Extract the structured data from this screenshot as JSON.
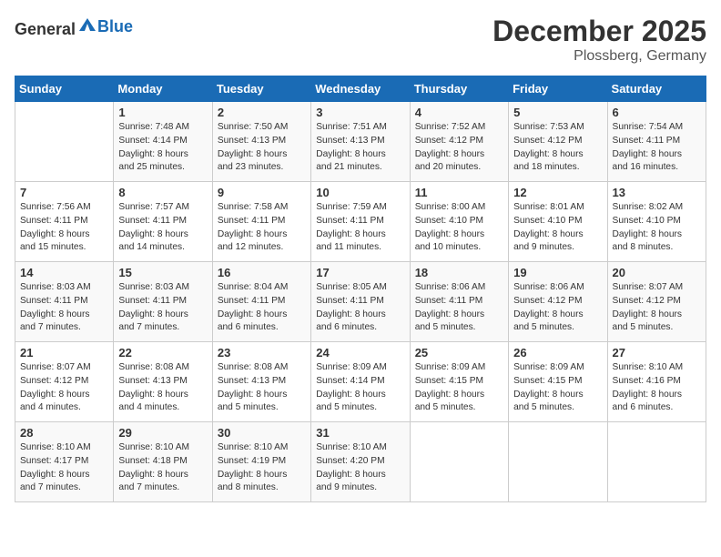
{
  "header": {
    "logo_general": "General",
    "logo_blue": "Blue",
    "month": "December 2025",
    "location": "Plossberg, Germany"
  },
  "days_of_week": [
    "Sunday",
    "Monday",
    "Tuesday",
    "Wednesday",
    "Thursday",
    "Friday",
    "Saturday"
  ],
  "weeks": [
    [
      {
        "num": "",
        "info": ""
      },
      {
        "num": "1",
        "info": "Sunrise: 7:48 AM\nSunset: 4:14 PM\nDaylight: 8 hours\nand 25 minutes."
      },
      {
        "num": "2",
        "info": "Sunrise: 7:50 AM\nSunset: 4:13 PM\nDaylight: 8 hours\nand 23 minutes."
      },
      {
        "num": "3",
        "info": "Sunrise: 7:51 AM\nSunset: 4:13 PM\nDaylight: 8 hours\nand 21 minutes."
      },
      {
        "num": "4",
        "info": "Sunrise: 7:52 AM\nSunset: 4:12 PM\nDaylight: 8 hours\nand 20 minutes."
      },
      {
        "num": "5",
        "info": "Sunrise: 7:53 AM\nSunset: 4:12 PM\nDaylight: 8 hours\nand 18 minutes."
      },
      {
        "num": "6",
        "info": "Sunrise: 7:54 AM\nSunset: 4:11 PM\nDaylight: 8 hours\nand 16 minutes."
      }
    ],
    [
      {
        "num": "7",
        "info": "Sunrise: 7:56 AM\nSunset: 4:11 PM\nDaylight: 8 hours\nand 15 minutes."
      },
      {
        "num": "8",
        "info": "Sunrise: 7:57 AM\nSunset: 4:11 PM\nDaylight: 8 hours\nand 14 minutes."
      },
      {
        "num": "9",
        "info": "Sunrise: 7:58 AM\nSunset: 4:11 PM\nDaylight: 8 hours\nand 12 minutes."
      },
      {
        "num": "10",
        "info": "Sunrise: 7:59 AM\nSunset: 4:11 PM\nDaylight: 8 hours\nand 11 minutes."
      },
      {
        "num": "11",
        "info": "Sunrise: 8:00 AM\nSunset: 4:10 PM\nDaylight: 8 hours\nand 10 minutes."
      },
      {
        "num": "12",
        "info": "Sunrise: 8:01 AM\nSunset: 4:10 PM\nDaylight: 8 hours\nand 9 minutes."
      },
      {
        "num": "13",
        "info": "Sunrise: 8:02 AM\nSunset: 4:10 PM\nDaylight: 8 hours\nand 8 minutes."
      }
    ],
    [
      {
        "num": "14",
        "info": "Sunrise: 8:03 AM\nSunset: 4:11 PM\nDaylight: 8 hours\nand 7 minutes."
      },
      {
        "num": "15",
        "info": "Sunrise: 8:03 AM\nSunset: 4:11 PM\nDaylight: 8 hours\nand 7 minutes."
      },
      {
        "num": "16",
        "info": "Sunrise: 8:04 AM\nSunset: 4:11 PM\nDaylight: 8 hours\nand 6 minutes."
      },
      {
        "num": "17",
        "info": "Sunrise: 8:05 AM\nSunset: 4:11 PM\nDaylight: 8 hours\nand 6 minutes."
      },
      {
        "num": "18",
        "info": "Sunrise: 8:06 AM\nSunset: 4:11 PM\nDaylight: 8 hours\nand 5 minutes."
      },
      {
        "num": "19",
        "info": "Sunrise: 8:06 AM\nSunset: 4:12 PM\nDaylight: 8 hours\nand 5 minutes."
      },
      {
        "num": "20",
        "info": "Sunrise: 8:07 AM\nSunset: 4:12 PM\nDaylight: 8 hours\nand 5 minutes."
      }
    ],
    [
      {
        "num": "21",
        "info": "Sunrise: 8:07 AM\nSunset: 4:12 PM\nDaylight: 8 hours\nand 4 minutes."
      },
      {
        "num": "22",
        "info": "Sunrise: 8:08 AM\nSunset: 4:13 PM\nDaylight: 8 hours\nand 4 minutes."
      },
      {
        "num": "23",
        "info": "Sunrise: 8:08 AM\nSunset: 4:13 PM\nDaylight: 8 hours\nand 5 minutes."
      },
      {
        "num": "24",
        "info": "Sunrise: 8:09 AM\nSunset: 4:14 PM\nDaylight: 8 hours\nand 5 minutes."
      },
      {
        "num": "25",
        "info": "Sunrise: 8:09 AM\nSunset: 4:15 PM\nDaylight: 8 hours\nand 5 minutes."
      },
      {
        "num": "26",
        "info": "Sunrise: 8:09 AM\nSunset: 4:15 PM\nDaylight: 8 hours\nand 5 minutes."
      },
      {
        "num": "27",
        "info": "Sunrise: 8:10 AM\nSunset: 4:16 PM\nDaylight: 8 hours\nand 6 minutes."
      }
    ],
    [
      {
        "num": "28",
        "info": "Sunrise: 8:10 AM\nSunset: 4:17 PM\nDaylight: 8 hours\nand 7 minutes."
      },
      {
        "num": "29",
        "info": "Sunrise: 8:10 AM\nSunset: 4:18 PM\nDaylight: 8 hours\nand 7 minutes."
      },
      {
        "num": "30",
        "info": "Sunrise: 8:10 AM\nSunset: 4:19 PM\nDaylight: 8 hours\nand 8 minutes."
      },
      {
        "num": "31",
        "info": "Sunrise: 8:10 AM\nSunset: 4:20 PM\nDaylight: 8 hours\nand 9 minutes."
      },
      {
        "num": "",
        "info": ""
      },
      {
        "num": "",
        "info": ""
      },
      {
        "num": "",
        "info": ""
      }
    ]
  ]
}
